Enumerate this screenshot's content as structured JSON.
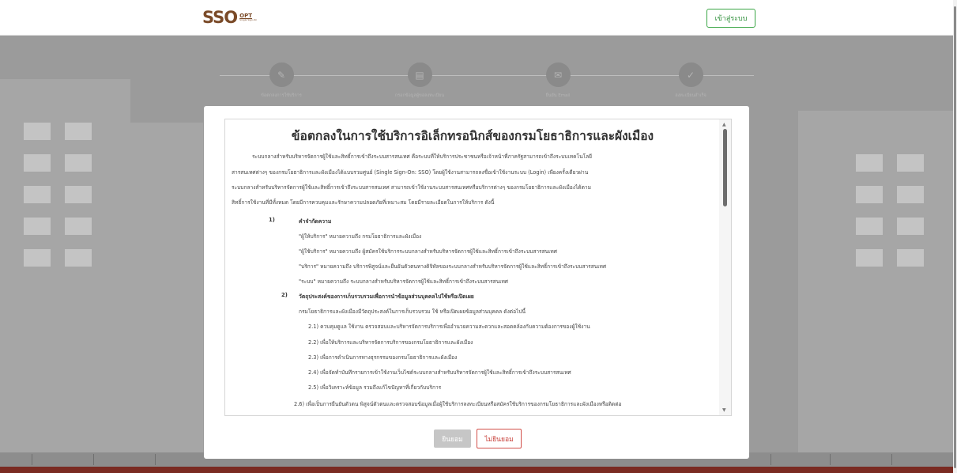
{
  "header": {
    "logo_text": "SSO",
    "logo_badge": "OPT",
    "logo_tiny": "Single Sign-On",
    "login_label": "เข้าสู่ระบบ"
  },
  "steps": [
    {
      "label": "ข้อตกลงการใช้บริการ",
      "icon": "edit-icon"
    },
    {
      "label": "กรอกข้อมูลผู้ขอลงทะเบียน",
      "icon": "id-card-icon"
    },
    {
      "label": "ยืนยัน Email",
      "icon": "envelope-icon"
    },
    {
      "label": "ลงทะเบียนสำเร็จ",
      "icon": "check-icon"
    }
  ],
  "terms": {
    "title": "ข้อตกลงในการใช้บริการอิเล็กทรอนิกส์ของกรมโยธาธิการและผังเมือง",
    "intro_lines": [
      "ระบบกลางสำหรับบริหารจัดการผู้ใช้และสิทธิ์การเข้าถึงระบบสารสนเทศ          คือระบบที่ให้บริการประชาชนหรือเจ้าหน้าที่ภาครัฐสามารถเข้าถึงระบบเทคโนโลยี",
      "สารสนเทศต่างๆ ของกรมโยธาธิการและผังเมืองได้แบบรวมศูนย์ (Single Sign-On: SSO)  โดยผู้ใช้งานสามารถลงชื่อเข้าใช้งานระบบ (Login) เพียงครั้งเดียวผ่าน",
      "ระบบกลางสำหรับบริหารจัดการผู้ใช้และสิทธิ์การเข้าถึงระบบสารสนเทศ   สามารถเข้าใช้งานระบบสารสนเทศหรือบริการต่างๆ   ของกรมโยธาธิการและผังเมืองได้ตาม",
      "สิทธิ์การใช้งานที่มีทั้งหมด โดยมีการควบคุมและรักษาความปลอดภัยที่เหมาะสม โดยมีรายละเอียดในการให้บริการ ดังนี้"
    ],
    "sections": [
      {
        "num": "1)",
        "title": "คำจำกัดความ",
        "items": [
          "\"ผู้ให้บริการ\" หมายความถึง กรมโยธาธิการและผังเมือง",
          "\"ผู้ใช้บริการ\" หมายความถึง ผู้สมัครใช้บริการระบบกลางสำหรับบริหารจัดการผู้ใช้และสิทธิ์การเข้าถึงระบบสารสนเทศ",
          "\"บริการ\" หมายความถึง บริการพิสูจน์และยืนยันตัวตนทางดิจิทัลของระบบกลางสำหรับบริหารจัดการผู้ใช้และสิทธิ์การเข้าถึงระบบสารสนเทศ",
          "\"ระบบ\" หมายความถึง ระบบกลางสำหรับบริหารจัดการผู้ใช้และสิทธิ์การเข้าถึงระบบสารสนเทศ"
        ]
      },
      {
        "num": "2)",
        "title": "วัตถุประสงค์ของการเก็บรวบรวมเพื่อการนำข้อมูลส่วนบุคคลไปใช้หรือเปิดเผย",
        "lead": "กรมโยธาธิการและผังเมืองมีวัตถุประสงค์ในการเก็บรวบรวม ใช้ หรือเปิดเผยข้อมูลส่วนบุคคล ดังต่อไปนี้",
        "items": [
          "2.1)   ควบคุมดูแล ใช้งาน ตรวจสอบและบริหารจัดการบริการเพื่ออำนวยความสะดวกและสอดคล้องกับความต้องการของผู้ใช้งาน",
          "2.2)   เพื่อให้บริการและบริหารจัดการบริการของกรมโยธาธิการและผังเมือง",
          "2.3)   เพื่อการดำเนินการทางธุรกรรมของกรมโยธาธิการและผังเมือง",
          "2.4)   เพื่อจัดทำบันทึกรายการเข้าใช้งานเว็บไซต์ระบบกลางสำหรับบริหารจัดการผู้ใช้และสิทธิ์การเข้าถึงระบบสารสนเทศ",
          "2.5)   เพื่อวิเคราะห์ข้อมูล รวมถึงแก้ไขปัญหาที่เกี่ยวกับบริการ"
        ],
        "last_item": "2.6) เพื่อเป็นการยืนยันตัวตน พิสูจน์ตัวตนและตรวจสอบข้อมูลเมื่อผู้ใช้บริการลงทะเบียนหรือสมัครใช้บริการของกรมโยธาธิการและผังเมืองหรือติดต่อ"
      }
    ]
  },
  "buttons": {
    "accept": "ยินยอม",
    "decline": "ไม่ยินยอม"
  }
}
